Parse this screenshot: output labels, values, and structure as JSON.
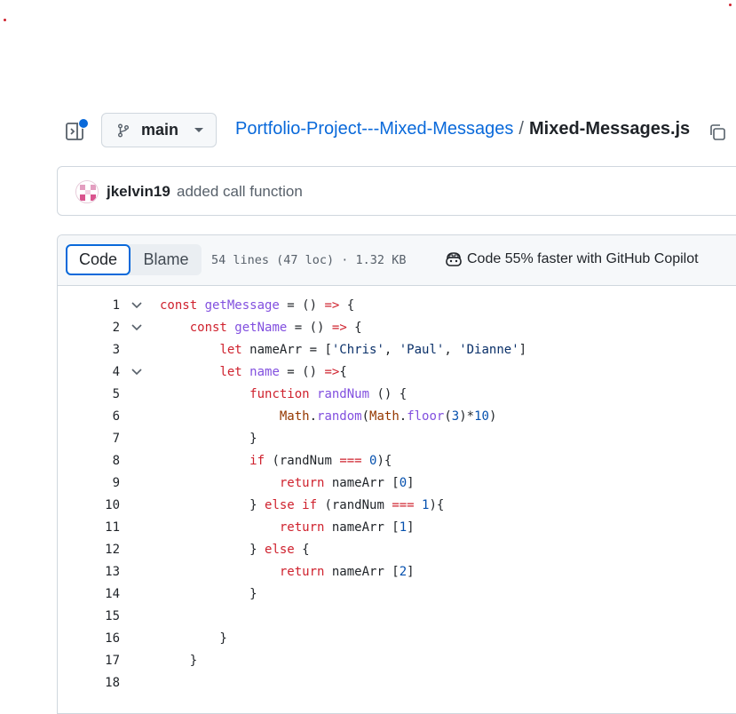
{
  "header": {
    "branch": "main",
    "breadcrumb_repo": "Portfolio-Project---Mixed-Messages",
    "breadcrumb_sep": "/",
    "breadcrumb_file": "Mixed-Messages.js"
  },
  "commit": {
    "author": "jkelvin19",
    "message": "added call function"
  },
  "file_header": {
    "tab_code": "Code",
    "tab_blame": "Blame",
    "meta": "54 lines (47 loc) · 1.32 KB",
    "copilot": "Code 55% faster with GitHub Copilot"
  },
  "colors": {
    "accent": "#0969da",
    "keyword": "#cf222e",
    "function": "#8250df",
    "string": "#0a3069",
    "number": "#0550ae"
  },
  "code": {
    "lines": [
      {
        "num": "1",
        "fold": true,
        "tokens": [
          [
            "k",
            "const "
          ],
          [
            "f",
            "getMessage"
          ],
          [
            "p",
            " = () "
          ],
          [
            "k",
            "=>"
          ],
          [
            "p",
            " {"
          ]
        ]
      },
      {
        "num": "2",
        "fold": true,
        "tokens": [
          [
            "p",
            "    "
          ],
          [
            "k",
            "const "
          ],
          [
            "f",
            "getName"
          ],
          [
            "p",
            " = () "
          ],
          [
            "k",
            "=>"
          ],
          [
            "p",
            " {"
          ]
        ]
      },
      {
        "num": "3",
        "fold": false,
        "tokens": [
          [
            "p",
            "        "
          ],
          [
            "k",
            "let "
          ],
          [
            "p",
            "nameArr = ["
          ],
          [
            "s",
            "'Chris'"
          ],
          [
            "p",
            ", "
          ],
          [
            "s",
            "'Paul'"
          ],
          [
            "p",
            ", "
          ],
          [
            "s",
            "'Dianne'"
          ],
          [
            "p",
            "]"
          ]
        ]
      },
      {
        "num": "4",
        "fold": true,
        "tokens": [
          [
            "p",
            "        "
          ],
          [
            "k",
            "let "
          ],
          [
            "f",
            "name"
          ],
          [
            "p",
            " = () "
          ],
          [
            "k",
            "=>"
          ],
          [
            "p",
            "{"
          ]
        ]
      },
      {
        "num": "5",
        "fold": false,
        "tokens": [
          [
            "p",
            "            "
          ],
          [
            "k",
            "function "
          ],
          [
            "f",
            "randNum"
          ],
          [
            "p",
            " () {"
          ]
        ]
      },
      {
        "num": "6",
        "fold": false,
        "tokens": [
          [
            "p",
            "                "
          ],
          [
            "c",
            "Math"
          ],
          [
            "p",
            "."
          ],
          [
            "f",
            "random"
          ],
          [
            "p",
            "("
          ],
          [
            "c",
            "Math"
          ],
          [
            "p",
            "."
          ],
          [
            "f",
            "floor"
          ],
          [
            "p",
            "("
          ],
          [
            "n",
            "3"
          ],
          [
            "p",
            ")*"
          ],
          [
            "n",
            "10"
          ],
          [
            "p",
            ")"
          ]
        ]
      },
      {
        "num": "7",
        "fold": false,
        "tokens": [
          [
            "p",
            "            }"
          ]
        ]
      },
      {
        "num": "8",
        "fold": false,
        "tokens": [
          [
            "p",
            "            "
          ],
          [
            "k",
            "if "
          ],
          [
            "p",
            "(randNum "
          ],
          [
            "k",
            "==="
          ],
          [
            "p",
            " "
          ],
          [
            "n",
            "0"
          ],
          [
            "p",
            "){"
          ]
        ]
      },
      {
        "num": "9",
        "fold": false,
        "tokens": [
          [
            "p",
            "                "
          ],
          [
            "k",
            "return "
          ],
          [
            "p",
            "nameArr ["
          ],
          [
            "n",
            "0"
          ],
          [
            "p",
            "]"
          ]
        ]
      },
      {
        "num": "10",
        "fold": false,
        "tokens": [
          [
            "p",
            "            } "
          ],
          [
            "k",
            "else if "
          ],
          [
            "p",
            "(randNum "
          ],
          [
            "k",
            "==="
          ],
          [
            "p",
            " "
          ],
          [
            "n",
            "1"
          ],
          [
            "p",
            "){"
          ]
        ]
      },
      {
        "num": "11",
        "fold": false,
        "tokens": [
          [
            "p",
            "                "
          ],
          [
            "k",
            "return "
          ],
          [
            "p",
            "nameArr ["
          ],
          [
            "n",
            "1"
          ],
          [
            "p",
            "]"
          ]
        ]
      },
      {
        "num": "12",
        "fold": false,
        "tokens": [
          [
            "p",
            "            } "
          ],
          [
            "k",
            "else "
          ],
          [
            "p",
            "{"
          ]
        ]
      },
      {
        "num": "13",
        "fold": false,
        "tokens": [
          [
            "p",
            "                "
          ],
          [
            "k",
            "return "
          ],
          [
            "p",
            "nameArr ["
          ],
          [
            "n",
            "2"
          ],
          [
            "p",
            "]"
          ]
        ]
      },
      {
        "num": "14",
        "fold": false,
        "tokens": [
          [
            "p",
            "            }"
          ]
        ]
      },
      {
        "num": "15",
        "fold": false,
        "tokens": [
          [
            "p",
            ""
          ]
        ]
      },
      {
        "num": "16",
        "fold": false,
        "tokens": [
          [
            "p",
            "        }"
          ]
        ]
      },
      {
        "num": "17",
        "fold": false,
        "tokens": [
          [
            "p",
            "    }"
          ]
        ]
      },
      {
        "num": "18",
        "fold": false,
        "tokens": [
          [
            "p",
            ""
          ]
        ]
      }
    ]
  }
}
